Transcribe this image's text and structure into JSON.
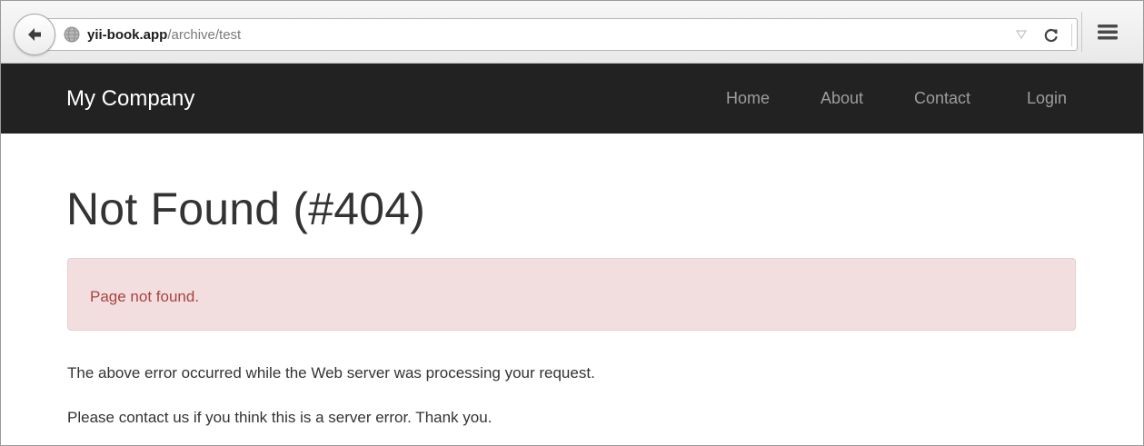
{
  "browser": {
    "url_host": "yii-book.app",
    "url_path": "/archive/test"
  },
  "navbar": {
    "brand": "My Company",
    "links": [
      "Home",
      "About",
      "Contact",
      "Login"
    ]
  },
  "main": {
    "title": "Not Found (#404)",
    "alert": "Page not found.",
    "paragraphs": [
      "The above error occurred while the Web server was processing your request.",
      "Please contact us if you think this is a server error. Thank you."
    ]
  },
  "colors": {
    "navbar_bg": "#222222",
    "nav_link": "#9d9d9d",
    "alert_bg": "#f2dede",
    "alert_text": "#a94442"
  },
  "icons": {
    "back": "back-arrow-icon",
    "site": "globe-icon",
    "dropdown": "dropdown-triangle-icon",
    "reload": "reload-icon",
    "menu": "hamburger-menu-icon"
  }
}
